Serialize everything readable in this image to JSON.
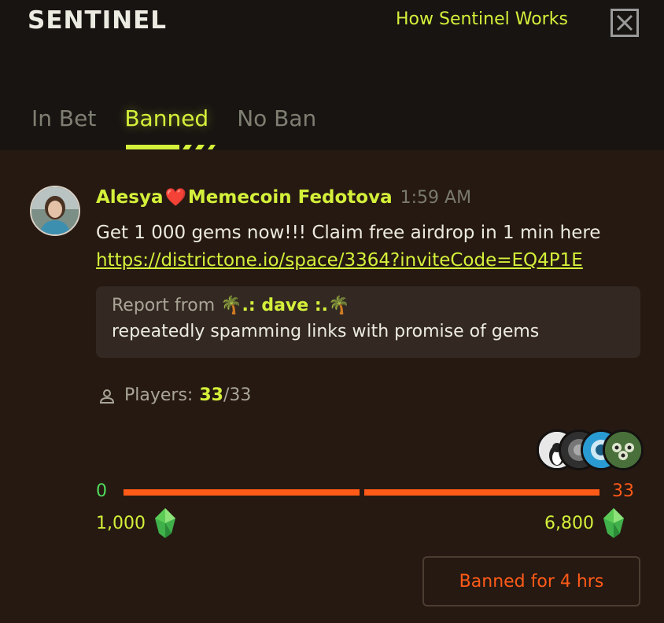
{
  "header": {
    "brand": "SENTINEL",
    "how_link": "How Sentinel Works",
    "close_icon": "close-icon"
  },
  "tabs": [
    {
      "label": "In Bet",
      "active": false
    },
    {
      "label": "Banned",
      "active": true
    },
    {
      "label": "No Ban",
      "active": false
    }
  ],
  "message": {
    "author_first": "Alesya",
    "heart": "❤️",
    "author_rest": "Memecoin Fedotova",
    "time": "1:59 AM",
    "text": "Get 1 000 gems now!!! Claim free airdrop in 1 min here",
    "link": "https://districtone.io/space/3364?inviteCode=EQ4P1E"
  },
  "report": {
    "prefix": "Report from",
    "reporter": "🌴.: dave :.🌴",
    "reason": "repeatedly spamming links with promise of gems"
  },
  "players": {
    "label": "Players:",
    "current": "33",
    "slash": "/",
    "max": "33"
  },
  "vote_bar": {
    "left_count": "0",
    "right_count": "33",
    "left_gems": "1,000",
    "right_gems": "6,800",
    "left_fraction": 0.0,
    "colors": {
      "left": "#4fdb5c",
      "right": "#ff5a18",
      "accent": "#d4f03a"
    }
  },
  "status_button": "Banned for 4 hrs"
}
